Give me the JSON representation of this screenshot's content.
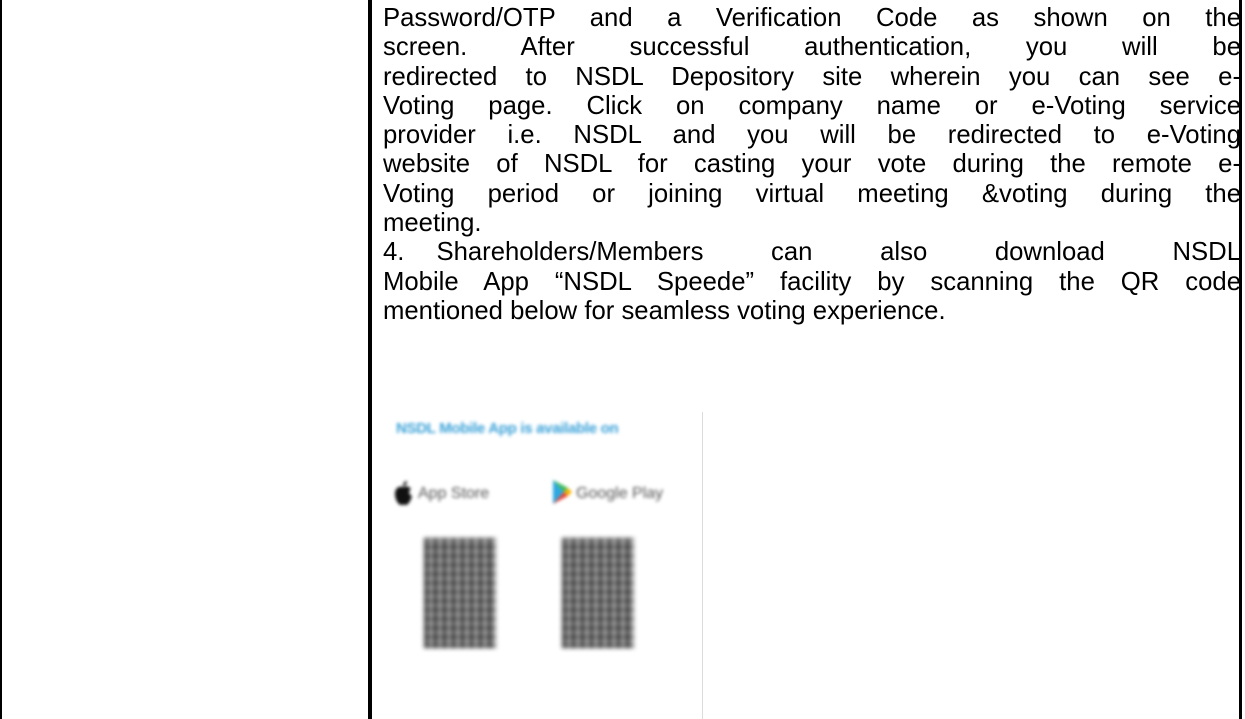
{
  "paragraph_lines": [
    "Password/OTP and a Verification Code as shown on the",
    "screen. After successful authentication, you will be",
    "redirected to NSDL Depository site wherein you can see e-",
    "Voting page. Click on company name or e-Voting service",
    "provider i.e. NSDL and you will be redirected to e-Voting",
    "website of NSDL for casting your vote during the remote e-",
    "Voting period or joining virtual meeting &voting during the",
    "meeting."
  ],
  "point4": {
    "number": "4.",
    "line1_text": "Shareholders/Members can also download NSDL",
    "line2": "Mobile App “NSDL Speede” facility by scanning the QR code",
    "line3": "mentioned below for seamless voting experience."
  },
  "app_image": {
    "heading": "NSDL Mobile App is available on",
    "apple_label": "App Store",
    "google_label": "Google Play",
    "apple_icon": "apple-logo-icon",
    "google_icon": "google-play-icon",
    "heading_color": "#3aa1d8"
  }
}
